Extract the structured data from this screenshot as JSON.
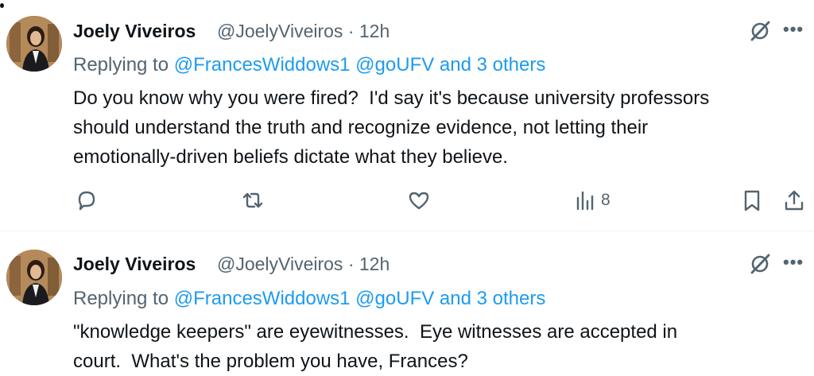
{
  "tweets": [
    {
      "author_name": "Joely Viveiros",
      "handle": "@JoelyViveiros · 12h",
      "replying_prefix": "Replying to",
      "replying_mentions": "@FrancesWiddows1 @goUFV and 3 others",
      "body": "Do you know why you were fired?  I'd say it's because university professors\nshould understand the truth and recognize evidence, not letting their\nemotionally-driven beliefs dictate what they believe.",
      "views": "8"
    },
    {
      "author_name": "Joely Viveiros",
      "handle": "@JoelyViveiros · 12h",
      "replying_prefix": "Replying to",
      "replying_mentions": "@FrancesWiddows1 @goUFV and 3 others",
      "body": "\"knowledge keepers\" are eyewitnesses.  Eye witnesses are accepted in\ncourt.  What's the problem you have, Frances?"
    }
  ],
  "icons": {
    "grok": "grok-icon",
    "more": "more-icon",
    "reply": "reply-icon",
    "retweet": "retweet-icon",
    "like": "like-icon",
    "views": "views-icon",
    "bookmark": "bookmark-icon",
    "share": "share-icon"
  },
  "colors": {
    "text": "#0f1419",
    "secondary": "#536471",
    "mention": "#1d9bf0",
    "divider": "#eff3f4"
  }
}
